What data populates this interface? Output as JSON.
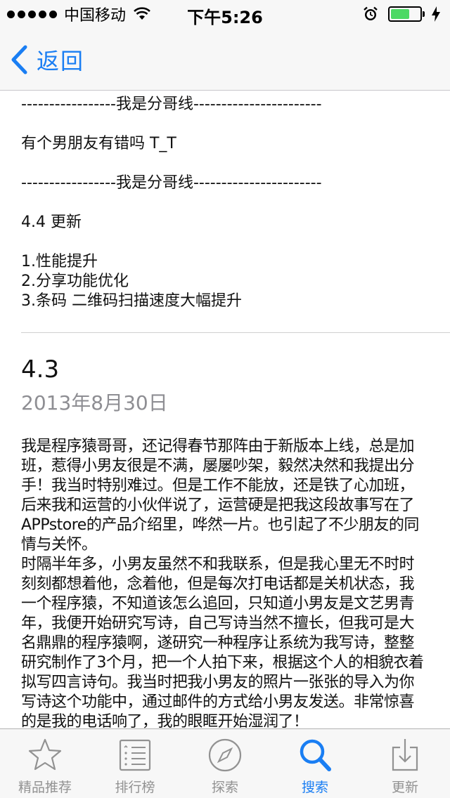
{
  "status_bar": {
    "carrier": "中国移动",
    "time": "下午5:26"
  },
  "nav": {
    "back_label": "返回"
  },
  "release_notes_top": [
    "-----------------我是分哥线-----------------------",
    "",
    "有个男朋友有错吗 T_T",
    "",
    "-----------------我是分哥线-----------------------",
    "",
    "4.4 更新",
    "",
    "1.性能提升",
    "2.分享功能优化",
    "3.条码 二维码扫描速度大幅提升"
  ],
  "version": {
    "number": "4.3",
    "date": "2013年8月30日",
    "body_p1": "我是程序猿哥哥，还记得春节那阵由于新版本上线，总是加班，惹得小男友很是不满，屡屡吵架，毅然决然和我提出分手！我当时特别难过。但是工作不能放，还是铁了心加班，后来我和运营的小伙伴说了，运营硬是把我这段故事写在了APPstore的产品介绍里，哗然一片。也引起了不少朋友的同情与关怀。",
    "body_p2": "时隔半年多，小男友虽然不和我联系，但是我心里无不时时刻刻都想着他，念着他，但是每次打电话都是关机状态，我一个程序猿，不知道该怎么追回，只知道小男友是文艺男青年，我便开始研究写诗，自己写诗当然不擅长，但我可是大名鼎鼎的程序猿啊，遂研究一种程序让系统为我写诗，整整研究制作了3个月，把一个人拍下来，根据这个人的相貌衣着拟写四言诗句。我当时把我小男友的照片一张张的导入为你写诗这个功能中，通过邮件的方式给小男友发送。非常惊喜的是我的电话响了，我的眼眶开始湿润了！"
  },
  "tabs": [
    {
      "label": "精品推荐",
      "icon": "star-icon",
      "active": false
    },
    {
      "label": "排行榜",
      "icon": "list-icon",
      "active": false
    },
    {
      "label": "探索",
      "icon": "compass-icon",
      "active": false
    },
    {
      "label": "搜索",
      "icon": "search-icon",
      "active": true
    },
    {
      "label": "更新",
      "icon": "update-icon",
      "active": false
    }
  ],
  "colors": {
    "accent": "#1a7ef3",
    "inactive_tab": "#929292",
    "date_gray": "#8e8e93",
    "battery_green": "#4cd964"
  }
}
